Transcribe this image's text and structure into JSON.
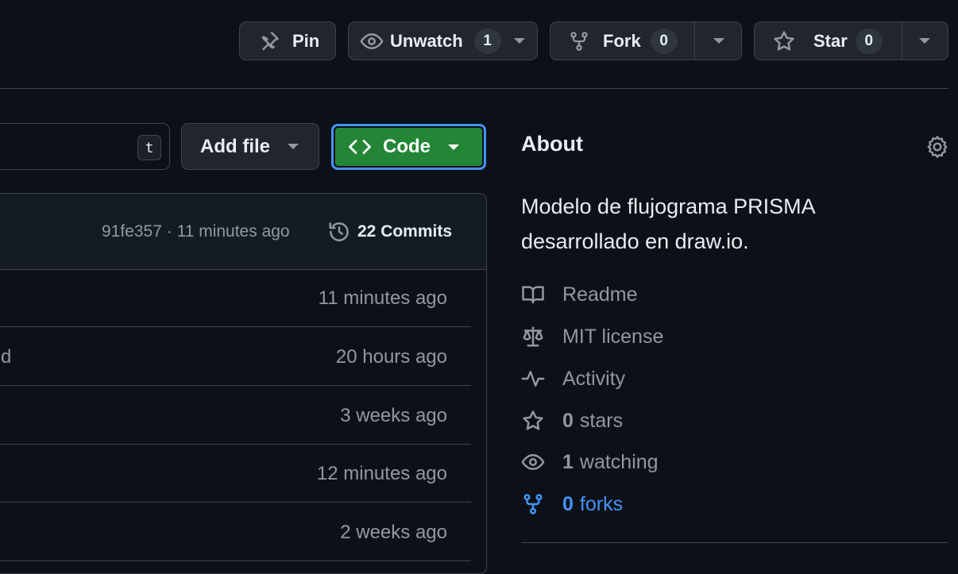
{
  "header": {
    "pin_label": "Pin",
    "watch_label": "Unwatch",
    "watch_count": "1",
    "fork_label": "Fork",
    "fork_count": "0",
    "star_label": "Star",
    "star_count": "0"
  },
  "toolbar": {
    "shortcut_key": "t",
    "add_file_label": "Add file",
    "code_label": "Code"
  },
  "commit_bar": {
    "hash_time": "91fe357 · 11 minutes ago",
    "commits_label": "22 Commits"
  },
  "files": [
    {
      "name": "",
      "time": "11 minutes ago"
    },
    {
      "name": "md",
      "time": "20 hours ago"
    },
    {
      "name": "",
      "time": "3 weeks ago"
    },
    {
      "name": "",
      "time": "12 minutes ago"
    },
    {
      "name": "",
      "time": "2 weeks ago"
    }
  ],
  "about": {
    "title": "About",
    "description_line1": "Modelo de flujograma PRISMA",
    "description_line2": "desarrollado en draw.io.",
    "readme": "Readme",
    "license": "MIT license",
    "activity": "Activity",
    "stars_count": "0",
    "stars_label": "stars",
    "watching_count": "1",
    "watching_label": "watching",
    "forks_count": "0",
    "forks_label": "forks"
  },
  "colors": {
    "background": "#0d1117",
    "code_button": "#238636",
    "link": "#4493f8",
    "muted": "#9198a1"
  },
  "icons": [
    "pin-icon",
    "eye-icon",
    "fork-icon",
    "star-icon",
    "history-icon",
    "gear-icon",
    "book-icon",
    "scale-icon",
    "pulse-icon",
    "chevron-left-right-icon",
    "caret-down-icon"
  ]
}
